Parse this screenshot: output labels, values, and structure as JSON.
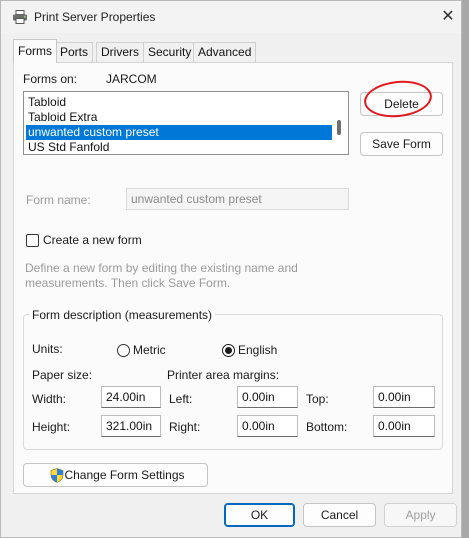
{
  "window": {
    "title": "Print Server Properties"
  },
  "tabs": [
    {
      "label": "Forms",
      "active": true
    },
    {
      "label": "Ports"
    },
    {
      "label": "Drivers"
    },
    {
      "label": "Security"
    },
    {
      "label": "Advanced"
    }
  ],
  "forms_on": {
    "label": "Forms on:",
    "server": "JARCOM"
  },
  "forms_list": [
    "Tabloid",
    "Tabloid Extra",
    "unwanted custom preset",
    "US Std Fanfold"
  ],
  "selected_form": "unwanted custom preset",
  "buttons": {
    "delete": "Delete",
    "save_form": "Save Form",
    "change_form_settings": "Change Form Settings",
    "ok": "OK",
    "cancel": "Cancel",
    "apply": "Apply"
  },
  "form_name": {
    "label": "Form name:",
    "value": "unwanted custom preset"
  },
  "create_new": {
    "label": "Create a new form",
    "checked": false
  },
  "description": "Define a new form by editing the existing name and measurements. Then click Save Form.",
  "measurements": {
    "group_title": "Form description (measurements)",
    "units_label": "Units:",
    "metric": "Metric",
    "english": "English",
    "selected_unit": "English",
    "paper_size_label": "Paper size:",
    "margins_label": "Printer area margins:",
    "width_label": "Width:",
    "width_value": "24.00in",
    "height_label": "Height:",
    "height_value": "321.00in",
    "left_label": "Left:",
    "left_value": "0.00in",
    "right_label": "Right:",
    "right_value": "0.00in",
    "top_label": "Top:",
    "top_value": "0.00in",
    "bottom_label": "Bottom:",
    "bottom_value": "0.00in"
  },
  "colors": {
    "selection": "#0078d7",
    "annotation": "#e0191f",
    "default_button": "#0067c0"
  },
  "icons": {
    "window": "printer-icon",
    "close": "close-icon",
    "shield": "uac-shield-icon"
  }
}
